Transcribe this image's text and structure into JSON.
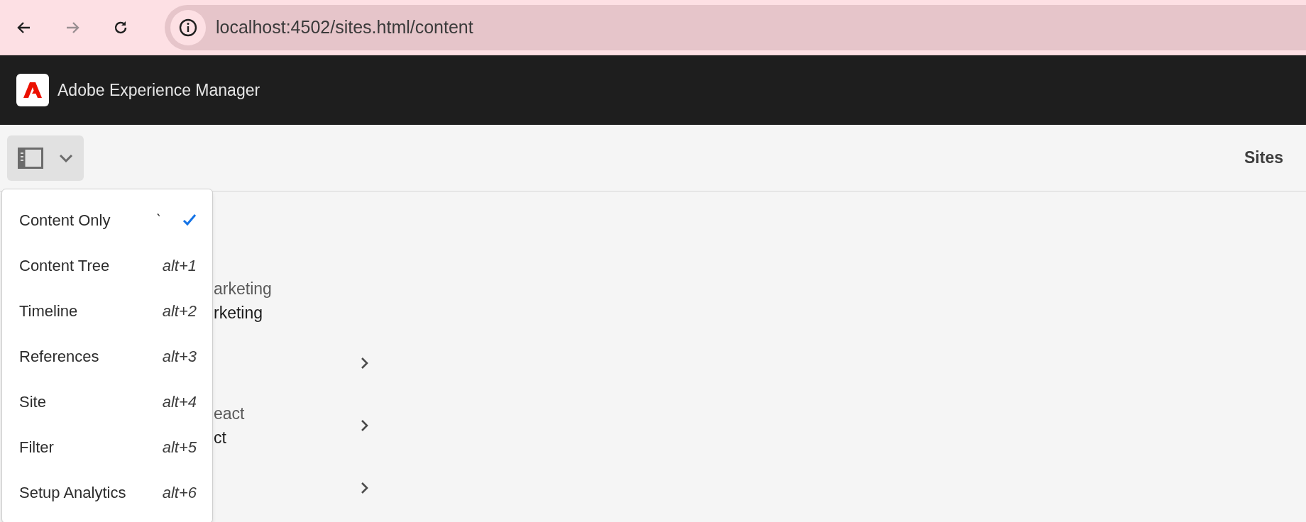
{
  "browser": {
    "nav": [
      {
        "kind": "back",
        "disabled": false
      },
      {
        "kind": "forward",
        "disabled": true
      },
      {
        "kind": "reload",
        "disabled": false
      }
    ],
    "url": "localhost:4502/sites.html/content"
  },
  "app_header": {
    "title": "Adobe Experience Manager"
  },
  "toolbar": {
    "title": "Sites"
  },
  "view_menu": {
    "expanded": true,
    "items": [
      {
        "label": "Content Only",
        "shortcut": "`",
        "selected": true
      },
      {
        "label": "Content Tree",
        "shortcut": "alt+1",
        "selected": false
      },
      {
        "label": "Timeline",
        "shortcut": "alt+2",
        "selected": false
      },
      {
        "label": "References",
        "shortcut": "alt+3",
        "selected": false
      },
      {
        "label": "Site",
        "shortcut": "alt+4",
        "selected": false
      },
      {
        "label": "Filter",
        "shortcut": "alt+5",
        "selected": false
      },
      {
        "label": "Setup Analytics",
        "shortcut": "alt+6",
        "selected": false
      }
    ]
  },
  "content_rows": [
    {
      "line_1": "arketing",
      "line_2": "rketing",
      "expandable": false
    },
    {
      "expandable": true
    },
    {
      "line_1": "eact",
      "line_2": "ct",
      "expandable": true
    },
    {
      "expandable": true
    }
  ]
}
